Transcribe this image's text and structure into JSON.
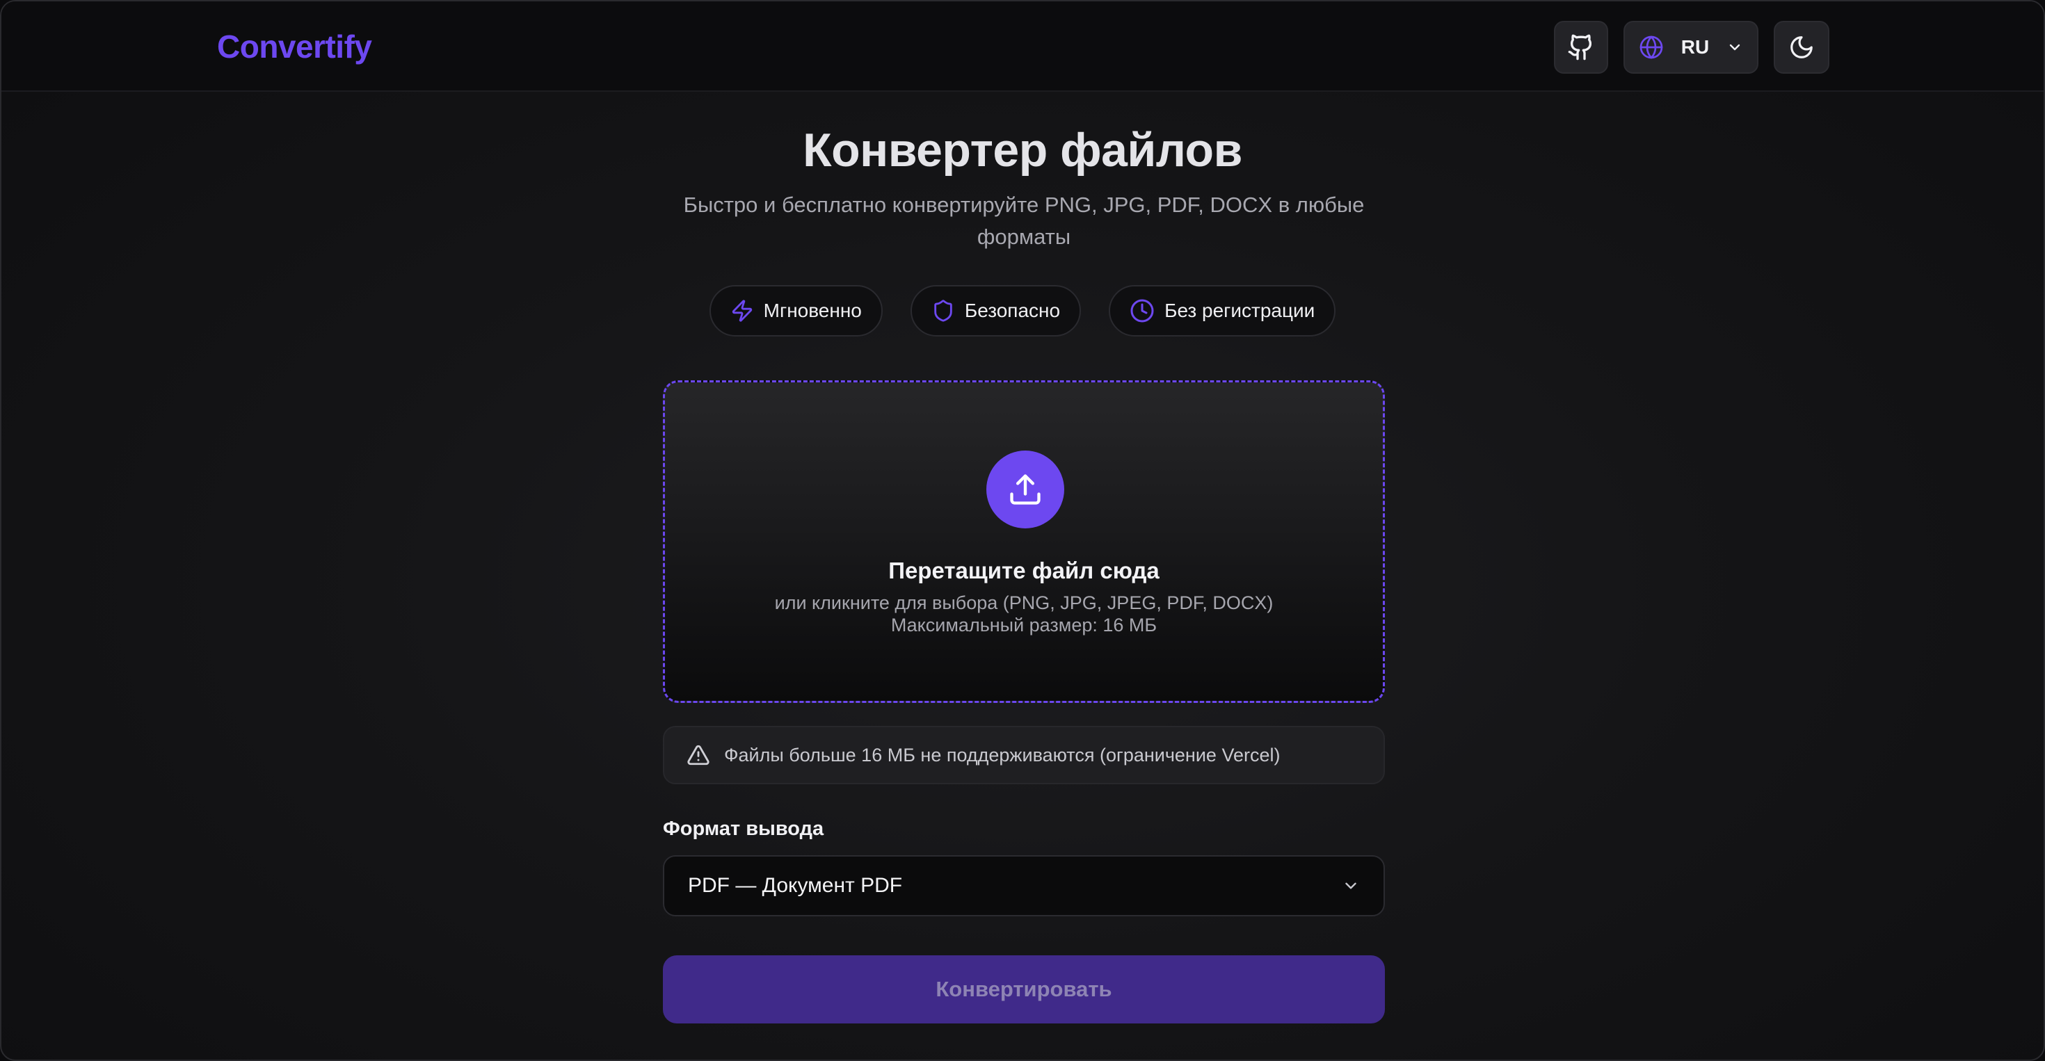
{
  "header": {
    "logo": "Convertify",
    "github_icon": "github-icon",
    "language": "RU",
    "language_icon": "globe-icon",
    "theme_icon": "moon-icon"
  },
  "hero": {
    "title": "Конвертер файлов",
    "subtitle": "Быстро и бесплатно конвертируйте PNG, JPG, PDF, DOCX в любые форматы"
  },
  "badges": [
    {
      "label": "Мгновенно",
      "icon": "lightning-icon"
    },
    {
      "label": "Безопасно",
      "icon": "shield-icon"
    },
    {
      "label": "Без регистрации",
      "icon": "clock-icon"
    }
  ],
  "dropzone": {
    "icon": "upload-icon",
    "title": "Перетащите файл сюда",
    "hint": "или кликните для выбора (PNG, JPG, JPEG, PDF, DOCX)",
    "max_size": "Максимальный размер: 16 МБ"
  },
  "alert": {
    "icon": "warning-triangle-icon",
    "text": "Файлы больше 16 МБ не поддерживаются (ограничение Vercel)"
  },
  "format": {
    "label": "Формат вывода",
    "selected": "PDF — Документ PDF"
  },
  "convert_button": "Конвертировать",
  "colors": {
    "accent": "#6d48f0",
    "button_disabled": "#402a8a",
    "background": "#151517"
  }
}
